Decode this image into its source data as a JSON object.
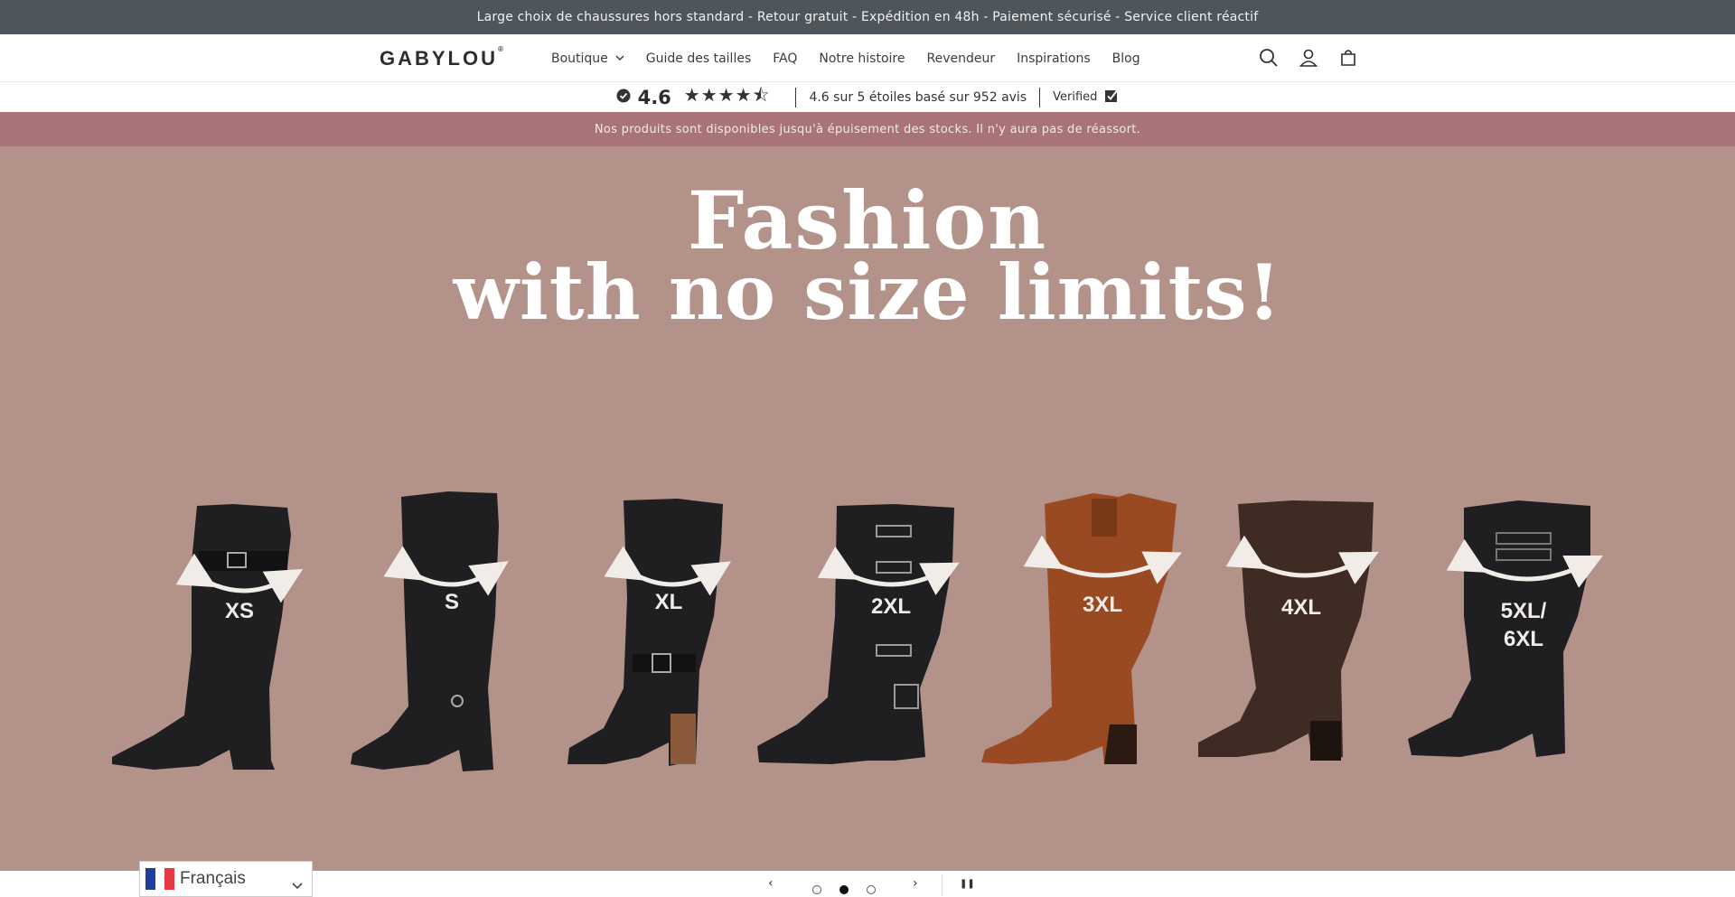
{
  "announcement": "Large choix de chaussures hors standard - Retour gratuit - Expédition en 48h - Paiement sécurisé - Service client réactif",
  "header": {
    "logo": "GABYLOU",
    "logo_mark": "®",
    "nav": [
      {
        "label": "Boutique",
        "has_dropdown": true
      },
      {
        "label": "Guide des tailles"
      },
      {
        "label": "FAQ"
      },
      {
        "label": "Notre histoire"
      },
      {
        "label": "Revendeur"
      },
      {
        "label": "Inspirations"
      },
      {
        "label": "Blog"
      }
    ],
    "icons": [
      "search-icon",
      "account-icon",
      "cart-icon"
    ]
  },
  "rating": {
    "score": "4.6",
    "stars": "★★★★⯪",
    "summary": "4.6 sur 5 étoiles basé sur 952 avis",
    "verified": "Verified"
  },
  "notice": "Nos produits sont disponibles jusqu'à épuisement des stocks. Il n'y aura pas de réassort.",
  "hero": {
    "title_line1": "Fashion",
    "title_line2": "with no size limits!",
    "sizes": [
      "XS",
      "S",
      "XL",
      "2XL",
      "3XL",
      "4XL",
      "5XL/",
      "6XL"
    ],
    "colors": {
      "background": "#b39289",
      "boot_black": "#1f1f22",
      "boot_cognac": "#9a4a22",
      "boot_brown": "#3e2b23"
    }
  },
  "slideshow": {
    "prev": "‹",
    "next": "›",
    "pause": "❚❚",
    "slide_count": 3,
    "active_slide": 2
  },
  "language": {
    "label": "Français",
    "flag_colors": [
      "#1f3d9e",
      "#ffffff",
      "#e63946"
    ]
  }
}
